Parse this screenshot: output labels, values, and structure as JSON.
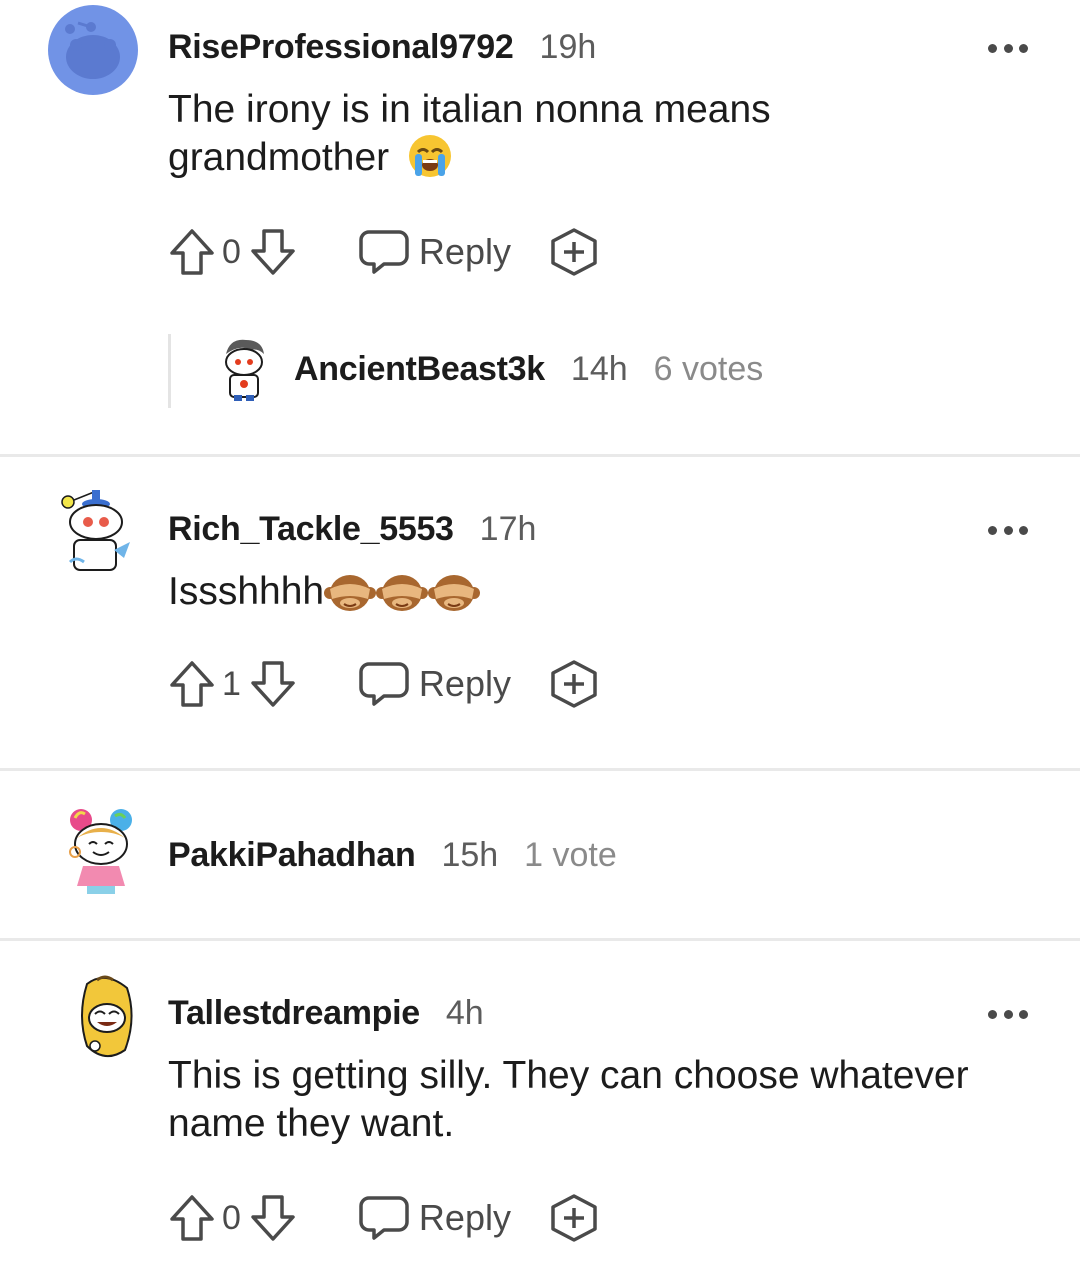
{
  "comments": [
    {
      "username": "RiseProfessional9792",
      "time": "19h",
      "text": "The irony is in italian nonna means grandmother",
      "votes": "0",
      "reply_label": "Reply"
    },
    {
      "username": "Rich_Tackle_5553",
      "time": "17h",
      "text": "Issshhhh",
      "votes": "1",
      "reply_label": "Reply"
    },
    {
      "username": "PakkiPahadhan",
      "time": "15h",
      "votes_text": "1 vote",
      "collapsed": true
    },
    {
      "username": "Tallestdreampie",
      "time": "4h",
      "text": "This is getting silly. They can choose whatever name they want.",
      "votes": "0",
      "reply_label": "Reply"
    }
  ],
  "collapsed_reply": {
    "username": "AncientBeast3k",
    "time": "14h",
    "votes_text": "6 votes"
  },
  "icons": {
    "upvote": "arrow-up-outline-icon",
    "downvote": "arrow-down-outline-icon",
    "reply": "speech-bubble-icon",
    "award": "award-plus-icon",
    "more": "ellipsis-icon",
    "emoji_1": "loudly-crying-face",
    "emoji_2": "see-no-evil-monkey"
  },
  "colors": {
    "text": "#1c1c1c",
    "meta": "#5c5c5c",
    "muted": "#8a8a8a",
    "icon": "#4a4a4a",
    "divider": "#e9e9e9",
    "avatar_blue": "#7193e6"
  }
}
